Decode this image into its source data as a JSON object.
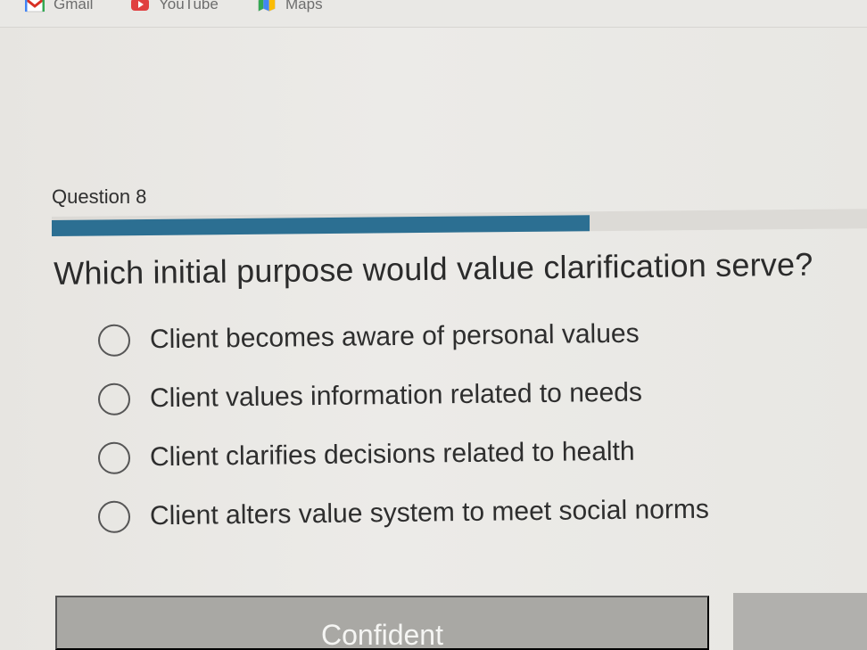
{
  "bookmarks": [
    {
      "label": "Gmail",
      "icon": "gmail-icon"
    },
    {
      "label": "YouTube",
      "icon": "youtube-icon"
    },
    {
      "label": "Maps",
      "icon": "maps-icon"
    }
  ],
  "question": {
    "label": "Question 8",
    "text": "Which initial purpose would value clarification serve?",
    "progress_fraction": 0.66
  },
  "options": [
    {
      "label": "Client becomes aware of personal values"
    },
    {
      "label": "Client values information related to needs"
    },
    {
      "label": "Client clarifies decisions related to health"
    },
    {
      "label": "Client alters value system to meet social norms"
    }
  ],
  "buttons": {
    "confident": "Confident"
  },
  "colors": {
    "progress": "#2c6f92",
    "button": "#a9a8a4"
  }
}
